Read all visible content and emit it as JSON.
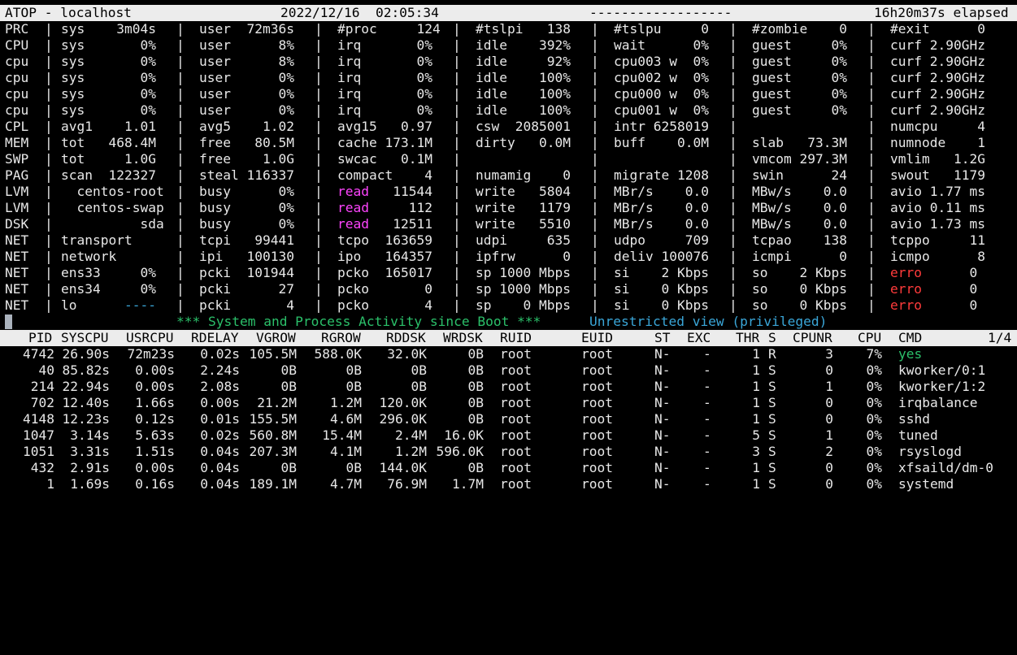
{
  "header": {
    "title": "ATOP - localhost",
    "datetime": "2022/12/16  02:05:34",
    "dashes": "------------------",
    "elapsed": "16h20m37s elapsed"
  },
  "system_rows": [
    {
      "label": "PRC",
      "c": [
        "sys    3m04s",
        "user  72m36s",
        "#proc     124",
        "#tslpi   138",
        "#tslpu     0",
        "#zombie    0",
        "#exit      0"
      ]
    },
    {
      "label": "CPU",
      "c": [
        "sys       0%",
        "user      8%",
        "irq       0%",
        "idle    392%",
        "wait      0%",
        "guest     0%",
        "curf 2.90GHz"
      ]
    },
    {
      "label": "cpu",
      "c": [
        "sys       0%",
        "user      8%",
        "irq       0%",
        "idle     92%",
        "cpu003 w  0%",
        "guest     0%",
        "curf 2.90GHz"
      ]
    },
    {
      "label": "cpu",
      "c": [
        "sys       0%",
        "user      0%",
        "irq       0%",
        "idle    100%",
        "cpu002 w  0%",
        "guest     0%",
        "curf 2.90GHz"
      ]
    },
    {
      "label": "cpu",
      "c": [
        "sys       0%",
        "user      0%",
        "irq       0%",
        "idle    100%",
        "cpu000 w  0%",
        "guest     0%",
        "curf 2.90GHz"
      ]
    },
    {
      "label": "cpu",
      "c": [
        "sys       0%",
        "user      0%",
        "irq       0%",
        "idle    100%",
        "cpu001 w  0%",
        "guest     0%",
        "curf 2.90GHz"
      ]
    },
    {
      "label": "CPL",
      "c": [
        "avg1    1.01",
        "avg5    1.02",
        "avg15   0.97",
        "csw  2085001",
        "intr 6258019",
        "",
        "numcpu     4"
      ]
    },
    {
      "label": "MEM",
      "c": [
        "tot   468.4M",
        "free   80.5M",
        "cache 173.1M",
        "dirty   0.0M",
        "buff    0.0M",
        "slab   73.3M",
        "numnode    1"
      ]
    },
    {
      "label": "SWP",
      "c": [
        "tot     1.0G",
        "free    1.0G",
        "swcac   0.1M",
        "",
        "",
        "vmcom 297.3M",
        "vmlim   1.2G"
      ]
    },
    {
      "label": "PAG",
      "c": [
        "scan  122327",
        "steal 116337",
        "compact    4",
        "numamig    0",
        "migrate 1208",
        "swin      24",
        "swout   1179"
      ]
    },
    {
      "label": "LVM",
      "c": [
        "  centos-root",
        "busy      0%",
        "read   11544",
        "write   5804",
        "MBr/s    0.0",
        "MBw/s    0.0",
        "avio 1.77 ms"
      ]
    },
    {
      "label": "LVM",
      "c": [
        "  centos-swap",
        "busy      0%",
        "read     112",
        "write   1179",
        "MBr/s    0.0",
        "MBw/s    0.0",
        "avio 0.11 ms"
      ]
    },
    {
      "label": "DSK",
      "c": [
        "          sda",
        "busy      0%",
        "read   12511",
        "write   5510",
        "MBr/s    0.0",
        "MBw/s    0.0",
        "avio 1.73 ms"
      ]
    },
    {
      "label": "NET",
      "c": [
        "transport",
        "tcpi   99441",
        "tcpo  163659",
        "udpi     635",
        "udpo     709",
        "tcpao    138",
        "tcppo     11"
      ]
    },
    {
      "label": "NET",
      "c": [
        "network",
        "ipi   100130",
        "ipo   164357",
        "ipfrw      0",
        "deliv 100076",
        "icmpi      0",
        "icmpo      8"
      ]
    },
    {
      "label": "NET",
      "c": [
        "ens33     0%",
        "pcki  101944",
        "pcko  165017",
        "sp 1000 Mbps",
        "si    2 Kbps",
        "so    2 Kbps",
        "erro      0"
      ]
    },
    {
      "label": "NET",
      "c": [
        "ens34     0%",
        "pcki      27",
        "pcko       0",
        "sp 1000 Mbps",
        "si    0 Kbps",
        "so    0 Kbps",
        "erro      0"
      ]
    },
    {
      "label": "NET",
      "c": [
        "lo      ----",
        "pcki       4",
        "pcko       4",
        "sp    0 Mbps",
        "si    0 Kbps",
        "so    0 Kbps",
        "erro      0"
      ]
    }
  ],
  "status_line": {
    "activity": "*** System and Process Activity since Boot ***",
    "view": "Unrestricted view (privileged)"
  },
  "process_table": {
    "headers": {
      "pid": "PID",
      "syscpu": "SYSCPU",
      "usrcpu": "USRCPU",
      "rdelay": "RDELAY",
      "vgrow": "VGROW",
      "rgrow": "RGROW",
      "rddsk": "RDDSK",
      "wrdsk": "WRDSK",
      "ruid": "RUID",
      "euid": "EUID",
      "st": "ST",
      "exc": "EXC",
      "thr": "THR",
      "s": "S",
      "cpunr": "CPUNR",
      "cpu": "CPU",
      "cmd": "CMD",
      "page": "1/4"
    },
    "rows": [
      {
        "pid": "4742",
        "syscpu": "26.90s",
        "usrcpu": "72m23s",
        "rdelay": "0.02s",
        "vgrow": "105.5M",
        "rgrow": "588.0K",
        "rddsk": "32.0K",
        "wrdsk": "0B",
        "ruid": "root",
        "euid": "root",
        "st": "N-",
        "exc": "-",
        "thr": "1",
        "s": "R",
        "cpunr": "3",
        "cpu": "7%",
        "cmd": "yes"
      },
      {
        "pid": "40",
        "syscpu": "85.82s",
        "usrcpu": "0.00s",
        "rdelay": "2.24s",
        "vgrow": "0B",
        "rgrow": "0B",
        "rddsk": "0B",
        "wrdsk": "0B",
        "ruid": "root",
        "euid": "root",
        "st": "N-",
        "exc": "-",
        "thr": "1",
        "s": "S",
        "cpunr": "0",
        "cpu": "0%",
        "cmd": "kworker/0:1"
      },
      {
        "pid": "214",
        "syscpu": "22.94s",
        "usrcpu": "0.00s",
        "rdelay": "2.08s",
        "vgrow": "0B",
        "rgrow": "0B",
        "rddsk": "0B",
        "wrdsk": "0B",
        "ruid": "root",
        "euid": "root",
        "st": "N-",
        "exc": "-",
        "thr": "1",
        "s": "S",
        "cpunr": "1",
        "cpu": "0%",
        "cmd": "kworker/1:2"
      },
      {
        "pid": "702",
        "syscpu": "12.40s",
        "usrcpu": "1.66s",
        "rdelay": "0.00s",
        "vgrow": "21.2M",
        "rgrow": "1.2M",
        "rddsk": "120.0K",
        "wrdsk": "0B",
        "ruid": "root",
        "euid": "root",
        "st": "N-",
        "exc": "-",
        "thr": "1",
        "s": "S",
        "cpunr": "0",
        "cpu": "0%",
        "cmd": "irqbalance"
      },
      {
        "pid": "4148",
        "syscpu": "12.23s",
        "usrcpu": "0.12s",
        "rdelay": "0.01s",
        "vgrow": "155.5M",
        "rgrow": "4.6M",
        "rddsk": "296.0K",
        "wrdsk": "0B",
        "ruid": "root",
        "euid": "root",
        "st": "N-",
        "exc": "-",
        "thr": "1",
        "s": "S",
        "cpunr": "0",
        "cpu": "0%",
        "cmd": "sshd"
      },
      {
        "pid": "1047",
        "syscpu": "3.14s",
        "usrcpu": "5.63s",
        "rdelay": "0.02s",
        "vgrow": "560.8M",
        "rgrow": "15.4M",
        "rddsk": "2.4M",
        "wrdsk": "16.0K",
        "ruid": "root",
        "euid": "root",
        "st": "N-",
        "exc": "-",
        "thr": "5",
        "s": "S",
        "cpunr": "1",
        "cpu": "0%",
        "cmd": "tuned"
      },
      {
        "pid": "1051",
        "syscpu": "3.31s",
        "usrcpu": "1.51s",
        "rdelay": "0.04s",
        "vgrow": "207.3M",
        "rgrow": "4.1M",
        "rddsk": "1.2M",
        "wrdsk": "596.0K",
        "ruid": "root",
        "euid": "root",
        "st": "N-",
        "exc": "-",
        "thr": "3",
        "s": "S",
        "cpunr": "2",
        "cpu": "0%",
        "cmd": "rsyslogd"
      },
      {
        "pid": "432",
        "syscpu": "2.91s",
        "usrcpu": "0.00s",
        "rdelay": "0.04s",
        "vgrow": "0B",
        "rgrow": "0B",
        "rddsk": "144.0K",
        "wrdsk": "0B",
        "ruid": "root",
        "euid": "root",
        "st": "N-",
        "exc": "-",
        "thr": "1",
        "s": "S",
        "cpunr": "0",
        "cpu": "0%",
        "cmd": "xfsaild/dm-0"
      },
      {
        "pid": "1",
        "syscpu": "1.69s",
        "usrcpu": "0.16s",
        "rdelay": "0.04s",
        "vgrow": "189.1M",
        "rgrow": "4.7M",
        "rddsk": "76.9M",
        "wrdsk": "1.7M",
        "ruid": "root",
        "euid": "root",
        "st": "N-",
        "exc": "-",
        "thr": "1",
        "s": "S",
        "cpunr": "0",
        "cpu": "0%",
        "cmd": "systemd"
      }
    ]
  },
  "colors": {
    "background": "#000000",
    "text": "#e8e8e8",
    "header_bar": "#ececec",
    "read_label": "#ff44ff",
    "error_label": "#ff3b3b",
    "active_process": "#2bc06a",
    "status_activity": "#2bc06a",
    "status_view": "#3aa6d8"
  }
}
